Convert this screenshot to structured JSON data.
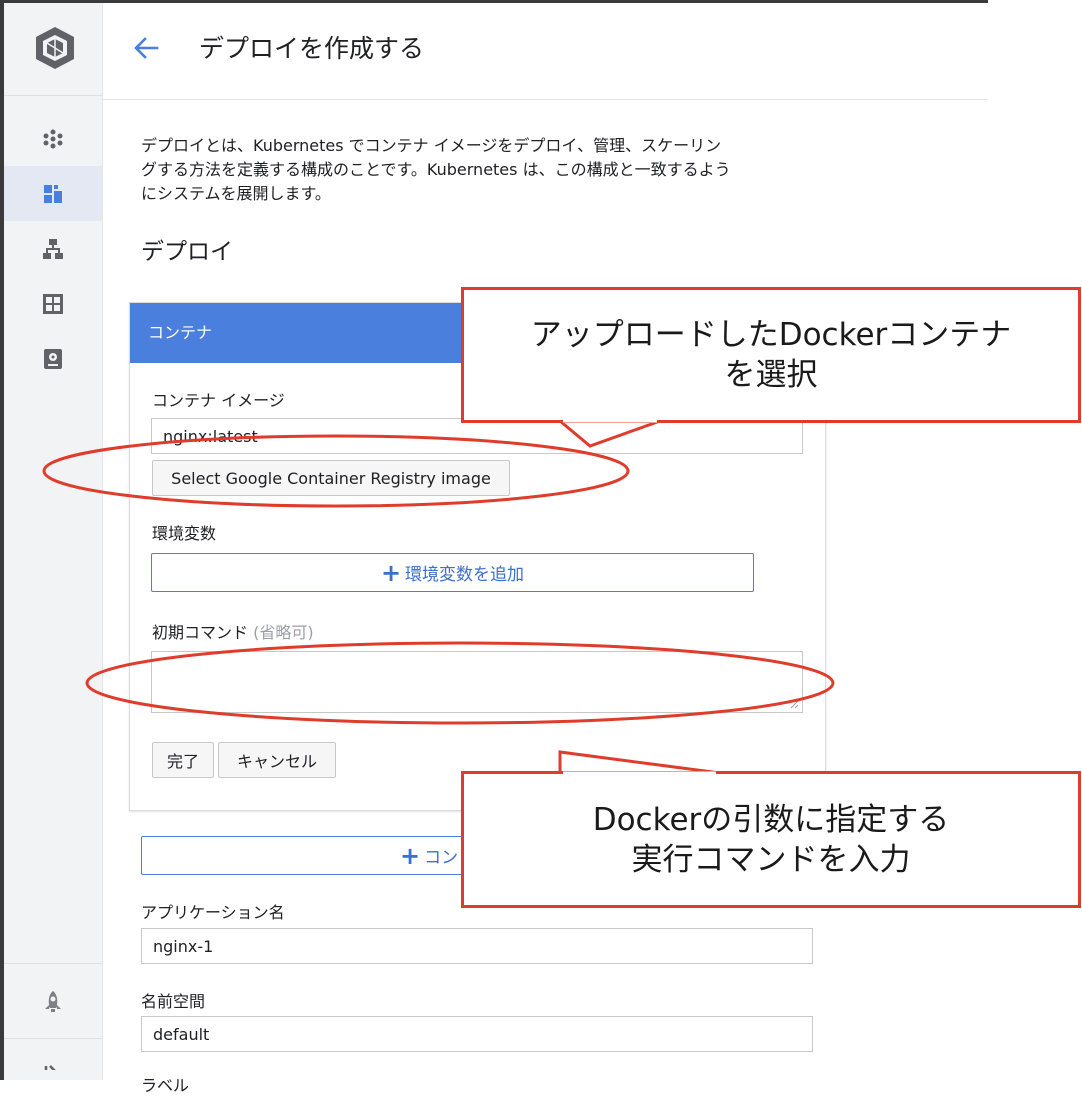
{
  "page": {
    "title": "デプロイを作成する",
    "intro_lines": [
      "デプロイとは、Kubernetes でコンテナ イメージをデプロイ、管理、スケーリン",
      "グする方法を定義する構成のことです。Kubernetes は、この構成と一致するよう",
      "にシステムを展開します。"
    ],
    "section_title": "デプロイ"
  },
  "container_card": {
    "header": "コンテナ",
    "image_label": "コンテナ イメージ",
    "image_value": "nginx:latest",
    "select_registry_button": "Select Google Container Registry image",
    "env_label": "環境変数",
    "add_env_button": "環境変数を追加",
    "command_label": "初期コマンド",
    "command_optional": "(省略可)",
    "command_value": "",
    "done_button": "完了",
    "cancel_button": "キャンセル"
  },
  "add_container_button": "コン",
  "app_name": {
    "label": "アプリケーション名",
    "value": "nginx-1"
  },
  "namespace": {
    "label": "名前空間",
    "value": "default"
  },
  "label_partial": "ラベル",
  "annotations": {
    "select_image": {
      "line1": "アップロードしたDockerコンテナ",
      "line2": "を選択"
    },
    "command": {
      "line1": "Dockerの引数に指定する",
      "line2": "実行コマンドを入力"
    }
  },
  "colors": {
    "accent": "#4a7fde",
    "annotation": "#e03c2c",
    "sidebar": "#f2f3f5"
  },
  "icons": {
    "logo": "kubernetes-logo-icon",
    "back": "arrow-left-icon",
    "nav": [
      "cluster-icon",
      "workloads-icon",
      "services-icon",
      "applications-icon",
      "config-icon",
      "marketplace-icon",
      "collapse-icon"
    ]
  }
}
